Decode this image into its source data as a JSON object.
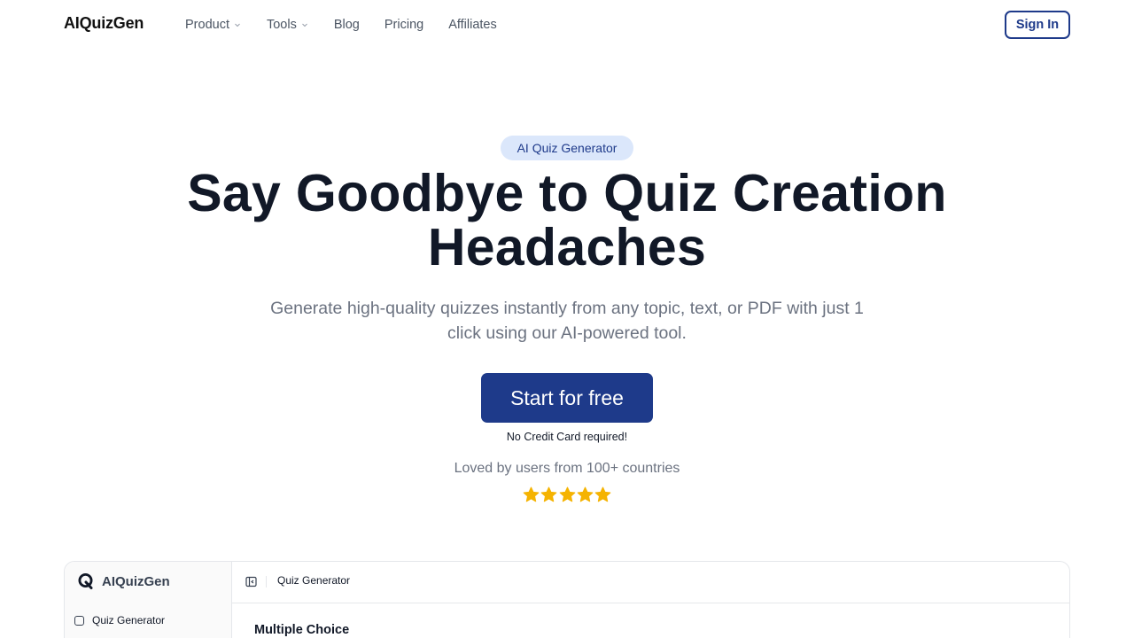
{
  "header": {
    "logo": "AIQuizGen",
    "nav": [
      {
        "label": "Product",
        "has_dropdown": true
      },
      {
        "label": "Tools",
        "has_dropdown": true
      },
      {
        "label": "Blog",
        "has_dropdown": false
      },
      {
        "label": "Pricing",
        "has_dropdown": false
      },
      {
        "label": "Affiliates",
        "has_dropdown": false
      }
    ],
    "signin_label": "Sign In"
  },
  "hero": {
    "badge": "AI Quiz Generator",
    "headline": "Say Goodbye to Quiz Creation Headaches",
    "subheadline": "Generate high-quality quizzes instantly from any topic, text, or PDF with just 1 click using our AI-powered tool.",
    "cta_label": "Start for free",
    "cta_note": "No Credit Card required!",
    "social_proof": "Loved by users from 100+ countries",
    "rating_stars": 5
  },
  "preview": {
    "logo": "AIQuizGen",
    "sidebar_items": [
      {
        "label": "Quiz Generator",
        "icon": "square-icon"
      }
    ],
    "breadcrumb": "Quiz Generator",
    "section_title": "Multiple Choice"
  },
  "colors": {
    "brand": "#1e3a8a",
    "badge_bg": "#dbe7fb",
    "star": "#f5b301",
    "muted_text": "#6b7280"
  }
}
